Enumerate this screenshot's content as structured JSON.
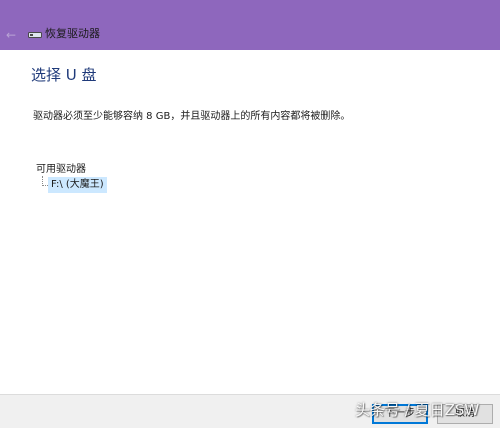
{
  "window": {
    "title": "恢复驱动器",
    "back_icon": "back-arrow-icon",
    "app_icon": "drive-icon"
  },
  "page": {
    "heading": "选择 U 盘",
    "description": "驱动器必须至少能够容纳 8 GB，并且驱动器上的所有内容都将被删除。"
  },
  "drives": {
    "header": "可用驱动器",
    "items": [
      {
        "label": "F:\\ (大魔王)",
        "selected": true
      }
    ]
  },
  "footer": {
    "next_label": "下一步",
    "cancel_label": "取消"
  },
  "watermark": "头条号 / 夏日ZSW",
  "colors": {
    "titlebar": "#8e67bd",
    "heading": "#1f3a7a",
    "selection": "#cce8ff",
    "focus_border": "#0078d7"
  }
}
